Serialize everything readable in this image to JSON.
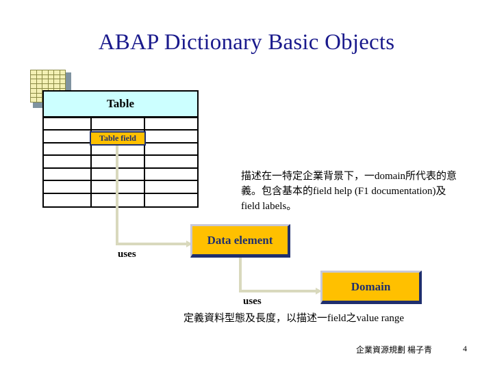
{
  "slide": {
    "title": "ABAP Dictionary Basic Objects",
    "title_color": "#1a1a8c",
    "background": "#ffffff"
  },
  "table_object": {
    "icon_name": "spreadsheet-grid-icon",
    "header_label": "Table",
    "header_color": "#ccffff",
    "columns": 3,
    "rows": 7,
    "field_badge_label": "Table field",
    "field_badge_color": "#ffc000",
    "field_badge_text_color": "#1f2f6e"
  },
  "connectors": [
    {
      "label": "uses",
      "from": "Table field",
      "to": "Data element",
      "color": "#d9d9bd"
    },
    {
      "label": "uses",
      "from": "Data element",
      "to": "Domain",
      "color": "#d9d9bd"
    }
  ],
  "boxes": {
    "data_element": {
      "label": "Data element",
      "fill": "#ffc000",
      "text_color": "#1f2f6e",
      "description": "描述在一特定企業背景下，一domain所代表的意義。包含基本的field help (F1 documentation)及field labels。"
    },
    "domain": {
      "label": "Domain",
      "fill": "#ffc000",
      "text_color": "#1f2f6e",
      "description": "定義資料型態及長度，以描述一field之value range"
    }
  },
  "footer": {
    "course": "企業資源規劃 楊子青",
    "page_number": "4"
  }
}
